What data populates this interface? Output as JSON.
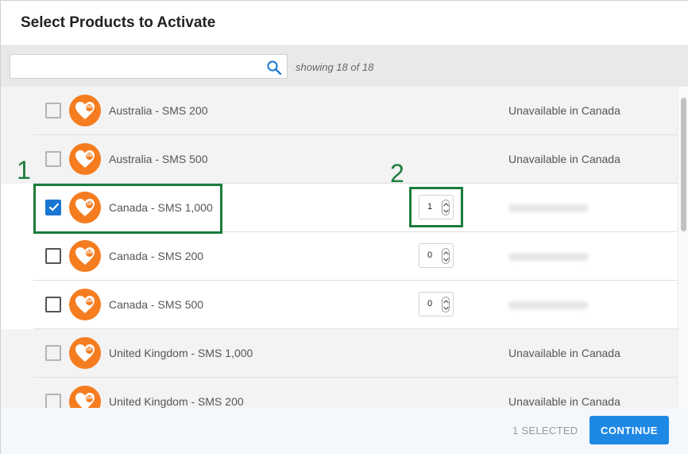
{
  "dialog": {
    "title": "Select Products to Activate"
  },
  "search": {
    "value": "",
    "placeholder": "",
    "showing_text": "showing 18 of 18"
  },
  "rows": [
    {
      "name": "Australia - SMS 200",
      "badge": "200",
      "checked": false,
      "enabled": false,
      "status": "Unavailable in Canada"
    },
    {
      "name": "Australia - SMS 500",
      "badge": "500",
      "checked": false,
      "enabled": false,
      "status": "Unavailable in Canada"
    },
    {
      "name": "Canada - SMS 1,000",
      "badge": "1K",
      "checked": true,
      "enabled": true,
      "quantity": "1"
    },
    {
      "name": "Canada - SMS 200",
      "badge": "200",
      "checked": false,
      "enabled": true,
      "quantity": "0"
    },
    {
      "name": "Canada - SMS 500",
      "badge": "500",
      "checked": false,
      "enabled": true,
      "quantity": "0"
    },
    {
      "name": "United Kingdom - SMS 1,000",
      "badge": "1K",
      "checked": false,
      "enabled": false,
      "status": "Unavailable in Canada"
    },
    {
      "name": "United Kingdom - SMS 200",
      "badge": "200",
      "checked": false,
      "enabled": false,
      "status": "Unavailable in Canada"
    }
  ],
  "annotations": {
    "first": "1",
    "second": "2"
  },
  "footer": {
    "selected_text": "1 SELECTED",
    "continue_label": "CONTINUE"
  },
  "colors": {
    "accent": "#1e88e5",
    "brand_orange": "#f57c1f",
    "highlight_green": "#1b7d3b"
  },
  "icons": {
    "search": "search-icon",
    "logo": "heart-logo-icon",
    "check": "check-icon",
    "spinner": "up-down-chevron-icon"
  }
}
